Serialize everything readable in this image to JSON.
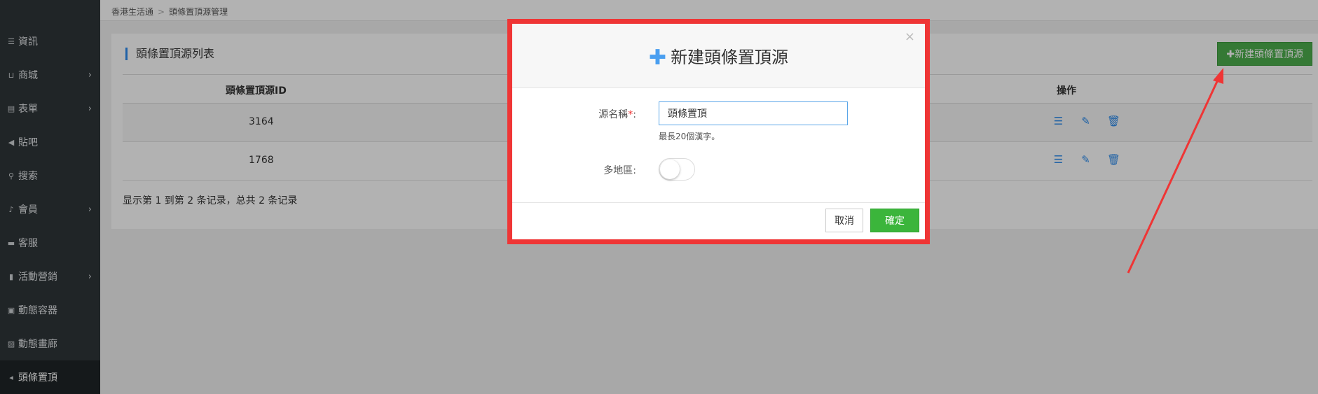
{
  "breadcrumb": {
    "root": "香港生活通",
    "separator": ">",
    "current": "頭條置頂源管理"
  },
  "sidebar": {
    "items": [
      {
        "label": "資訊",
        "icon": "list-icon",
        "glyph": "☰",
        "has_sub": false
      },
      {
        "label": "商城",
        "icon": "cart-icon",
        "glyph": "⊔",
        "has_sub": true
      },
      {
        "label": "表單",
        "icon": "form-icon",
        "glyph": "▤",
        "has_sub": true
      },
      {
        "label": "貼吧",
        "icon": "megaphone-icon",
        "glyph": "◀",
        "has_sub": false
      },
      {
        "label": "搜索",
        "icon": "search-icon",
        "glyph": "⚲",
        "has_sub": false
      },
      {
        "label": "會員",
        "icon": "bell-icon",
        "glyph": "♪",
        "has_sub": true
      },
      {
        "label": "客服",
        "icon": "comment-icon",
        "glyph": "▬",
        "has_sub": false
      },
      {
        "label": "活動營銷",
        "icon": "bookmark-icon",
        "glyph": "▮",
        "has_sub": true
      },
      {
        "label": "動態容器",
        "icon": "container-icon",
        "glyph": "▣",
        "has_sub": false
      },
      {
        "label": "動態畫廊",
        "icon": "image-icon",
        "glyph": "▨",
        "has_sub": false
      },
      {
        "label": "頭條置頂",
        "icon": "volume-icon",
        "glyph": "◂",
        "has_sub": false,
        "active": true
      }
    ]
  },
  "panel": {
    "title": "頭條置頂源列表",
    "add_button": "✚新建頭條置頂源",
    "columns": {
      "id": "頭條置頂源ID",
      "actions": "操作"
    },
    "rows": [
      {
        "id": "3164"
      },
      {
        "id": "1768"
      }
    ],
    "summary": "显示第 1 到第 2 条记录，总共 2 条记录"
  },
  "modal": {
    "plus": "✚",
    "title": "新建頭條置頂源",
    "close": "×",
    "name_label": "源名稱",
    "required_mark": "*",
    "colon": ":",
    "name_value": "頭條置頂",
    "name_hint": "最長20個漢字。",
    "multi_region_label": "多地區:",
    "multi_region_enabled": false,
    "cancel": "取消",
    "confirm": "確定"
  },
  "colors": {
    "sidebar_bg": "#2f3538",
    "accent_blue": "#2e8ded",
    "confirm_green": "#3bb53b",
    "highlight_red": "#ef3535"
  }
}
